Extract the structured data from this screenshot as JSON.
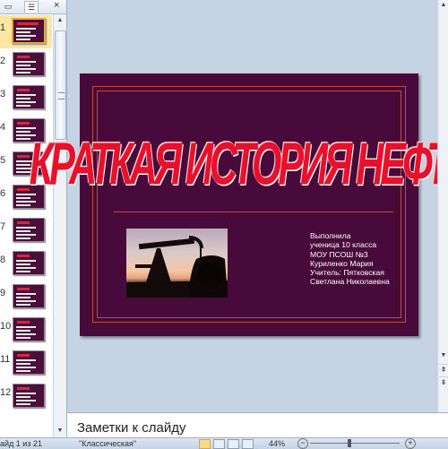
{
  "thumbnail_pane": {
    "tab_slides_icon": "slides-tab-icon",
    "tab_outline_icon": "outline-tab-icon",
    "close_label": "×",
    "slides": [
      {
        "number": "1",
        "selected": true
      },
      {
        "number": "2"
      },
      {
        "number": "3"
      },
      {
        "number": "4"
      },
      {
        "number": "5"
      },
      {
        "number": "6"
      },
      {
        "number": "7"
      },
      {
        "number": "8"
      },
      {
        "number": "9"
      },
      {
        "number": "10"
      },
      {
        "number": "11"
      },
      {
        "number": "12"
      }
    ]
  },
  "slide": {
    "title": "КРАТКАЯ ИСТОРИЯ НЕФТИ",
    "author_lines": [
      "Выполнила",
      "ученица  10 класса",
      "МОУ  ПСОШ  №3",
      "Куриленко  Мария",
      "Учитель:  Пятковская",
      "Светлана  Николаевна"
    ],
    "photo_icon": "oil-pump-photo",
    "colors": {
      "background": "#470a3a",
      "frame": "#c54a3d",
      "title": "#e8102a"
    }
  },
  "notes": {
    "placeholder": "Заметки к слайду"
  },
  "status_bar": {
    "slide_counter": "айд 1 из 21",
    "theme_name": "\"Классическая\"",
    "zoom": "44%"
  }
}
